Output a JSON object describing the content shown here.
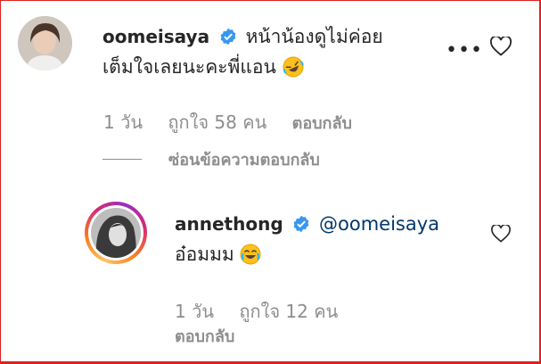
{
  "comment": {
    "username": "oomeisaya",
    "text_line1": "หน้าน้องดูไม่ค่อย",
    "text_line2": "เต็มใจเลยนะคะพี่แอน",
    "time": "1 วัน",
    "likes": "ถูกใจ 58 คน",
    "reply_label": "ตอบกลับ",
    "emoji": "rofl-emoji"
  },
  "hide_replies_label": "ซ่อนข้อความตอบกลับ",
  "reply": {
    "username": "annethong",
    "mention": "@oomeisaya",
    "text": "อ๋อมมม",
    "time": "1 วัน",
    "likes": "ถูกใจ 12 คน",
    "reply_label": "ตอบกลับ",
    "emoji": "tears-of-joy-emoji"
  },
  "colors": {
    "verified": "#3897f0",
    "muted": "#8e8e8e",
    "mention": "#00376b",
    "frame": "#e02020"
  }
}
